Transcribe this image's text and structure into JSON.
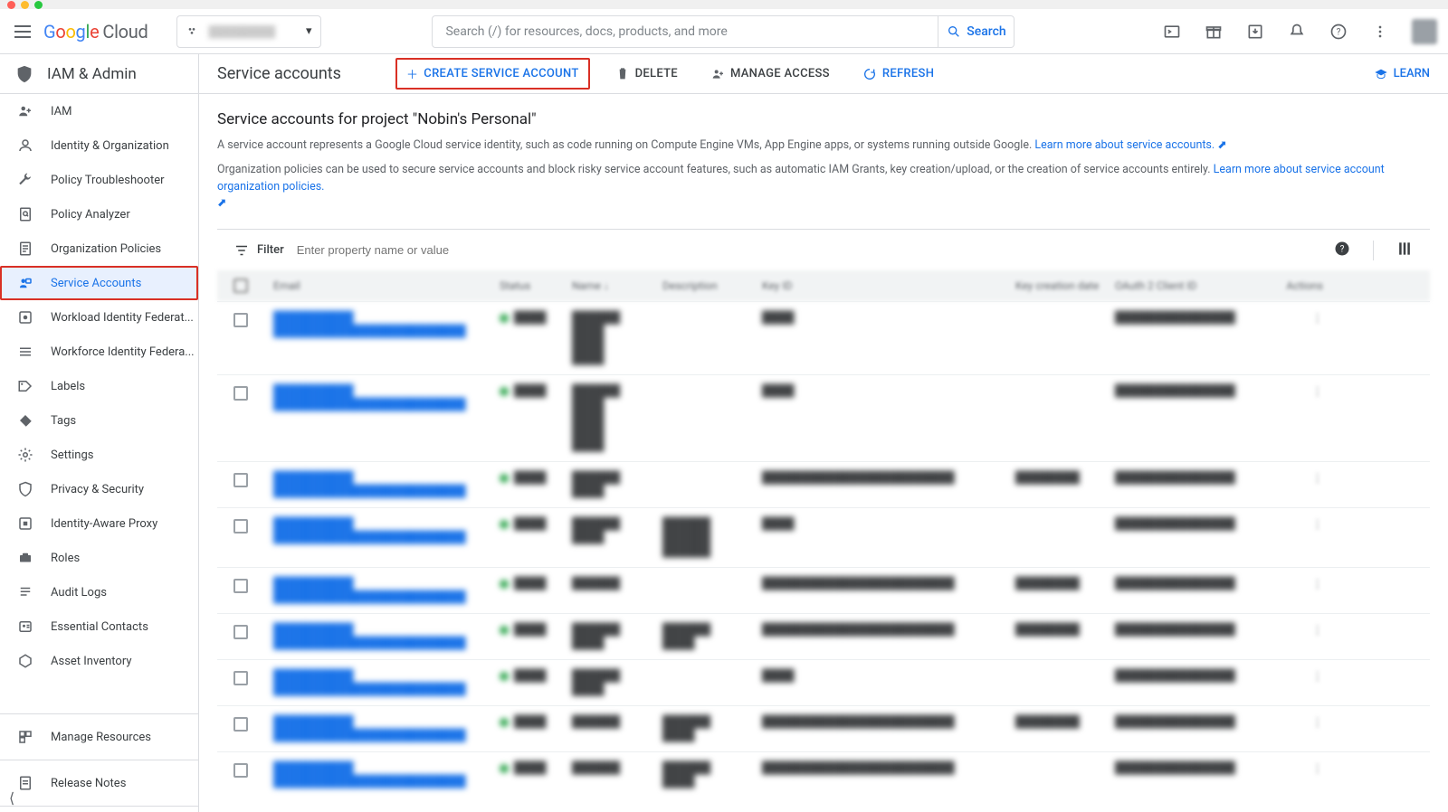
{
  "window": {
    "os_title_bar": true
  },
  "header": {
    "logo_cloud_text": "Cloud",
    "project_picker_label": "▒▒▒▒▒▒▒▒",
    "search_placeholder": "Search (/) for resources, docs, products, and more",
    "search_button": "Search"
  },
  "sidebar": {
    "section_title": "IAM & Admin",
    "items": [
      {
        "icon": "iam",
        "label": "IAM"
      },
      {
        "icon": "identity",
        "label": "Identity & Organization"
      },
      {
        "icon": "wrench",
        "label": "Policy Troubleshooter"
      },
      {
        "icon": "analyzer",
        "label": "Policy Analyzer"
      },
      {
        "icon": "doc",
        "label": "Organization Policies"
      },
      {
        "icon": "service-accounts",
        "label": "Service Accounts",
        "active": true
      },
      {
        "icon": "workload",
        "label": "Workload Identity Federat..."
      },
      {
        "icon": "workforce",
        "label": "Workforce Identity Federa..."
      },
      {
        "icon": "labels",
        "label": "Labels"
      },
      {
        "icon": "tags",
        "label": "Tags"
      },
      {
        "icon": "settings",
        "label": "Settings"
      },
      {
        "icon": "shield",
        "label": "Privacy & Security"
      },
      {
        "icon": "iap",
        "label": "Identity-Aware Proxy"
      },
      {
        "icon": "roles",
        "label": "Roles"
      },
      {
        "icon": "logs",
        "label": "Audit Logs"
      },
      {
        "icon": "contacts",
        "label": "Essential Contacts"
      },
      {
        "icon": "assets",
        "label": "Asset Inventory"
      }
    ],
    "footer_items": [
      {
        "icon": "manage",
        "label": "Manage Resources"
      },
      {
        "icon": "notes",
        "label": "Release Notes"
      }
    ]
  },
  "actionbar": {
    "page_title": "Service accounts",
    "create": "CREATE SERVICE ACCOUNT",
    "delete": "DELETE",
    "manage": "MANAGE ACCESS",
    "refresh": "REFRESH",
    "learn": "LEARN"
  },
  "content": {
    "heading": "Service accounts for project \"Nobin's Personal\"",
    "desc1_pre": "A service account represents a Google Cloud service identity, such as code running on Compute Engine VMs, App Engine apps, or systems running outside Google. ",
    "desc1_link": "Learn more about service accounts.",
    "desc2_pre": "Organization policies can be used to secure service accounts and block risky service account features, such as automatic IAM Grants, key creation/upload, or the creation of service accounts entirely. ",
    "desc2_link": "Learn more about service account organization policies."
  },
  "filter": {
    "label": "Filter",
    "placeholder": "Enter property name or value"
  },
  "table": {
    "columns": [
      "",
      "Email",
      "Status",
      "Name",
      "Description",
      "Key ID",
      "Key creation date",
      "OAuth 2 Client ID",
      "Actions"
    ],
    "rows": [
      {
        "email_l1": "██████████",
        "email_l2": "████████████████████████",
        "status": "████",
        "name": "██████\n████\n████\n████",
        "desc": "",
        "keyid": "████",
        "keyc": "",
        "oauth": "███████████████"
      },
      {
        "email_l1": "██████████",
        "email_l2": "████████████████████████",
        "status": "████",
        "name": "██████\n████\n████\n████\n████",
        "desc": "",
        "keyid": "████",
        "keyc": "",
        "oauth": "███████████████"
      },
      {
        "email_l1": "██████████",
        "email_l2": "████████████████████████",
        "status": "████",
        "name": "██████\n████",
        "desc": "",
        "keyid": "████████████████████████",
        "keyc": "████████",
        "oauth": "███████████████"
      },
      {
        "email_l1": "██████████",
        "email_l2": "████████████████████████",
        "status": "████",
        "name": "██████\n████",
        "desc": "██████\n██████\n██████",
        "keyid": "████",
        "keyc": "",
        "oauth": "███████████████"
      },
      {
        "email_l1": "██████████",
        "email_l2": "████████████████████████",
        "status": "████",
        "name": "██████",
        "desc": "",
        "keyid": "████████████████████████",
        "keyc": "████████",
        "oauth": "███████████████"
      },
      {
        "email_l1": "██████████",
        "email_l2": "████████████████████████",
        "status": "████",
        "name": "██████\n████",
        "desc": "██████\n████",
        "keyid": "████████████████████████",
        "keyc": "████████",
        "oauth": "███████████████"
      },
      {
        "email_l1": "██████████",
        "email_l2": "████████████████████████",
        "status": "████",
        "name": "██████\n████",
        "desc": "",
        "keyid": "████",
        "keyc": "",
        "oauth": "███████████████"
      },
      {
        "email_l1": "██████████",
        "email_l2": "████████████████████████",
        "status": "████",
        "name": "██████",
        "desc": "██████\n████",
        "keyid": "████████████████████████",
        "keyc": "████████",
        "oauth": "███████████████"
      },
      {
        "email_l1": "██████████",
        "email_l2": "████████████████████████",
        "status": "████",
        "name": "██████",
        "desc": "██████\n████",
        "keyid": "████████████████████████",
        "keyc": "",
        "oauth": "███████████████"
      }
    ]
  }
}
